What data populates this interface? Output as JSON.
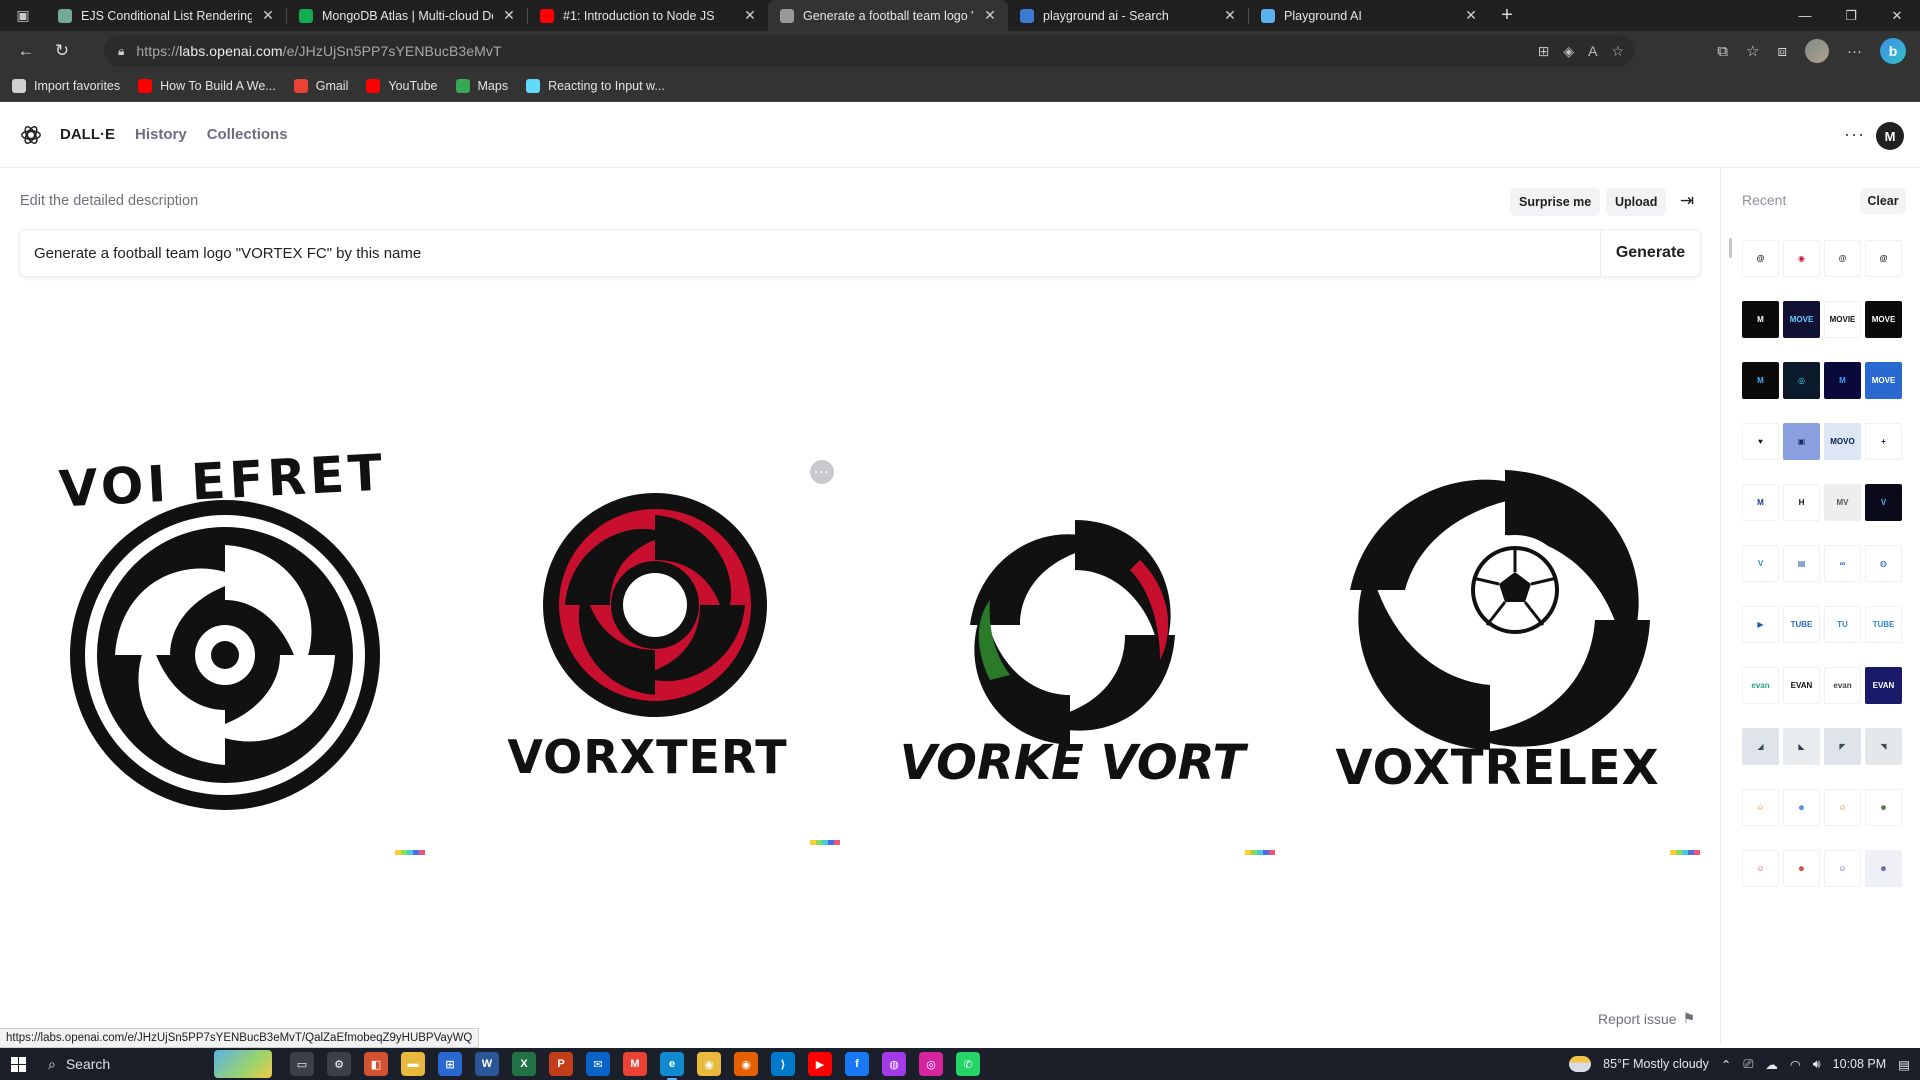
{
  "browser": {
    "tabs": [
      {
        "title": "EJS Conditional List Rendering",
        "favicon_color": "#74aa9c",
        "active": false
      },
      {
        "title": "MongoDB Atlas | Multi-cloud De",
        "favicon_color": "#13aa52",
        "active": false
      },
      {
        "title": "#1: Introduction to Node JS",
        "favicon_color": "#ff0000",
        "active": false
      },
      {
        "title": "Generate a football team logo \"V",
        "favicon_color": "#9a9a9a",
        "active": true
      },
      {
        "title": "playground ai - Search",
        "favicon_color": "#3a7bd5",
        "active": false
      },
      {
        "title": "Playground AI",
        "favicon_color": "#5ab1ef",
        "active": false
      }
    ],
    "address_host": "labs.openai.com",
    "address_scheme": "https://",
    "address_path": "/e/JHzUjSn5PP7sYENBucB3eMvT",
    "bookmarks": [
      {
        "label": "Import favorites",
        "icon": "folder-icon",
        "color": "#d0d0d0"
      },
      {
        "label": "How To Build A We...",
        "icon": "youtube-icon",
        "color": "#ff0000"
      },
      {
        "label": "Gmail",
        "icon": "gmail-icon",
        "color": "#ea4335"
      },
      {
        "label": "YouTube",
        "icon": "youtube-icon",
        "color": "#ff0000"
      },
      {
        "label": "Maps",
        "icon": "maps-icon",
        "color": "#34a853"
      },
      {
        "label": "Reacting to Input w...",
        "icon": "react-icon",
        "color": "#61dafb"
      }
    ],
    "status_url": "https://labs.openai.com/e/JHzUjSn5PP7sYENBucB3eMvT/QalZaEfmobeqZ9yHUBPVayWQ"
  },
  "app": {
    "brand": "DALL·E",
    "nav": [
      "History",
      "Collections"
    ],
    "avatar_initial": "M",
    "edit_label": "Edit the detailed description",
    "surprise_label": "Surprise me",
    "upload_label": "Upload",
    "prompt": "Generate a football team logo \"VORTEX FC\" by this name",
    "generate_label": "Generate",
    "report_label": "Report issue",
    "results": [
      {
        "wordmark": "VOI EFRET",
        "accent": "#111111"
      },
      {
        "wordmark": "VORXTERT",
        "accent": "#c8102e"
      },
      {
        "wordmark": "VORKE VORT",
        "accent": "#c8102e"
      },
      {
        "wordmark": "VOXTRELEX",
        "accent": "#111111"
      }
    ]
  },
  "sidebar": {
    "recent_label": "Recent",
    "clear_label": "Clear",
    "thumbs": [
      {
        "bg": "#ffffff",
        "fg": "#111111",
        "text": "@"
      },
      {
        "bg": "#ffffff",
        "fg": "#c8102e",
        "text": "◉"
      },
      {
        "bg": "#ffffff",
        "fg": "#333333",
        "text": "@"
      },
      {
        "bg": "#ffffff",
        "fg": "#111111",
        "text": "@"
      },
      {
        "bg": "#0a0a0a",
        "fg": "#ffffff",
        "text": "M"
      },
      {
        "bg": "#111133",
        "fg": "#5fd0ff",
        "text": "MOVE"
      },
      {
        "bg": "#ffffff",
        "fg": "#111111",
        "text": "MOVIE"
      },
      {
        "bg": "#0a0a0a",
        "fg": "#ffffff",
        "text": "MOVE"
      },
      {
        "bg": "#0a0a0a",
        "fg": "#4fb0ff",
        "text": "M"
      },
      {
        "bg": "#0a1a2a",
        "fg": "#4fd0ff",
        "text": "◎"
      },
      {
        "bg": "#0a0a3a",
        "fg": "#3fa0ff",
        "text": "M"
      },
      {
        "bg": "#2a6ad0",
        "fg": "#ffffff",
        "text": "MOVE"
      },
      {
        "bg": "#ffffff",
        "fg": "#111133",
        "text": "♥"
      },
      {
        "bg": "#8aa0e0",
        "fg": "#1a2a6a",
        "text": "▣"
      },
      {
        "bg": "#dce6f5",
        "fg": "#0a1a4a",
        "text": "MOVO"
      },
      {
        "bg": "#ffffff",
        "fg": "#0a1a4a",
        "text": "+"
      },
      {
        "bg": "#ffffff",
        "fg": "#1a3a8a",
        "text": "M"
      },
      {
        "bg": "#ffffff",
        "fg": "#111111",
        "text": "H"
      },
      {
        "bg": "#eeeeee",
        "fg": "#555555",
        "text": "MV"
      },
      {
        "bg": "#0a0a1a",
        "fg": "#4fb0ff",
        "text": "V"
      },
      {
        "bg": "#ffffff",
        "fg": "#2a8ad0",
        "text": "V"
      },
      {
        "bg": "#ffffff",
        "fg": "#1a4ab0",
        "text": "▤"
      },
      {
        "bg": "#ffffff",
        "fg": "#2a6ad0",
        "text": "∞"
      },
      {
        "bg": "#ffffff",
        "fg": "#1a5ab0",
        "text": "◍"
      },
      {
        "bg": "#ffffff",
        "fg": "#1a5ab0",
        "text": "▶"
      },
      {
        "bg": "#ffffff",
        "fg": "#2a6ad0",
        "text": "TUBE"
      },
      {
        "bg": "#ffffff",
        "fg": "#2a8ad0",
        "text": "TU"
      },
      {
        "bg": "#ffffff",
        "fg": "#2a8ad0",
        "text": "TUBE"
      },
      {
        "bg": "#ffffff",
        "fg": "#2aa08a",
        "text": "evan"
      },
      {
        "bg": "#ffffff",
        "fg": "#111111",
        "text": "EVAN"
      },
      {
        "bg": "#ffffff",
        "fg": "#444444",
        "text": "evan"
      },
      {
        "bg": "#1a1a6a",
        "fg": "#ffffff",
        "text": "EVAN"
      },
      {
        "bg": "#dfe4ea",
        "fg": "#3a4a5a",
        "text": "◢"
      },
      {
        "bg": "#e8ecef",
        "fg": "#2a3a4a",
        "text": "◣"
      },
      {
        "bg": "#dfe4ea",
        "fg": "#3a4a5a",
        "text": "◤"
      },
      {
        "bg": "#e4e8eb",
        "fg": "#3a4a5a",
        "text": "◥"
      },
      {
        "bg": "#ffffff",
        "fg": "#d47a2a",
        "text": "☺"
      },
      {
        "bg": "#ffffff",
        "fg": "#3a8ad0",
        "text": "☻"
      },
      {
        "bg": "#ffffff",
        "fg": "#b0902a",
        "text": "☺"
      },
      {
        "bg": "#ffffff",
        "fg": "#4a6a3a",
        "text": "☻"
      },
      {
        "bg": "#ffffff",
        "fg": "#d04a4a",
        "text": "☺"
      },
      {
        "bg": "#ffffff",
        "fg": "#c83a2a",
        "text": "☻"
      },
      {
        "bg": "#ffffff",
        "fg": "#5a3aa0",
        "text": "☺"
      },
      {
        "bg": "#eef0f5",
        "fg": "#5a5aa0",
        "text": "☻"
      }
    ]
  },
  "taskbar": {
    "search_label": "Search",
    "apps": [
      {
        "name": "task-view",
        "color": "#3a3f4a",
        "glyph": "▭"
      },
      {
        "name": "settings",
        "color": "#3a3f4a",
        "glyph": "⚙"
      },
      {
        "name": "powerpoint-orange",
        "color": "#d35230",
        "glyph": "◧"
      },
      {
        "name": "file-explorer",
        "color": "#e8b93c",
        "glyph": "▬"
      },
      {
        "name": "ms-store",
        "color": "#2a6ad0",
        "glyph": "⊞"
      },
      {
        "name": "word",
        "color": "#2b579a",
        "glyph": "W"
      },
      {
        "name": "excel",
        "color": "#217346",
        "glyph": "X"
      },
      {
        "name": "powerpoint",
        "color": "#c43e1c",
        "glyph": "P"
      },
      {
        "name": "mail",
        "color": "#0a64c8",
        "glyph": "✉"
      },
      {
        "name": "gmail",
        "color": "#ea4335",
        "glyph": "M"
      },
      {
        "name": "edge",
        "color": "#0f8ad0",
        "glyph": "e"
      },
      {
        "name": "chrome",
        "color": "#e8b93c",
        "glyph": "◉"
      },
      {
        "name": "firefox",
        "color": "#e66000",
        "glyph": "◉"
      },
      {
        "name": "vscode",
        "color": "#007acc",
        "glyph": "⟩"
      },
      {
        "name": "youtube",
        "color": "#ff0000",
        "glyph": "▶"
      },
      {
        "name": "facebook",
        "color": "#1877f2",
        "glyph": "f"
      },
      {
        "name": "messenger",
        "color": "#a33ae8",
        "glyph": "◍"
      },
      {
        "name": "instagram",
        "color": "#d6249f",
        "glyph": "◎"
      },
      {
        "name": "whatsapp",
        "color": "#25d366",
        "glyph": "✆"
      }
    ],
    "weather": "85°F  Mostly cloudy",
    "time": "10:08 PM"
  }
}
